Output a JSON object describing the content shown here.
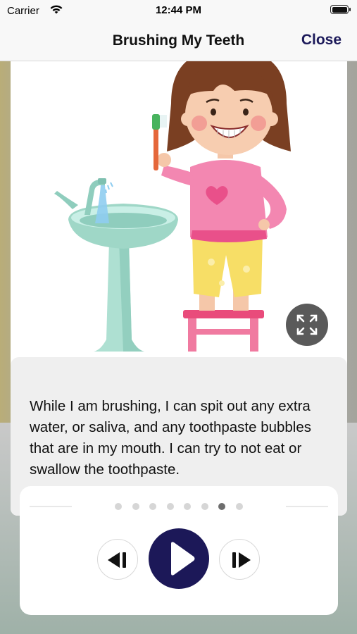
{
  "status_bar": {
    "carrier": "Carrier",
    "time": "12:44 PM",
    "icons": [
      "wifi-icon",
      "battery-icon"
    ]
  },
  "nav": {
    "title": "Brushing My Teeth",
    "close_label": "Close"
  },
  "illustration": {
    "description_icon": "girl-brushing-teeth-at-sink-illustration"
  },
  "story": {
    "text": "While I am brushing, I can spit out any extra water, or saliva, and any toothpaste bubbles that are in my mouth. I can try to not eat or swallow the toothpaste."
  },
  "pager": {
    "total_pages": 8,
    "current_page": 7
  },
  "controls": {
    "icons": [
      "previous-icon",
      "play-icon",
      "next-icon",
      "expand-icon"
    ]
  },
  "colors": {
    "accent": "#1c1858",
    "close_text": "#1c1a5a",
    "expand_button": "#5a5a5a"
  }
}
